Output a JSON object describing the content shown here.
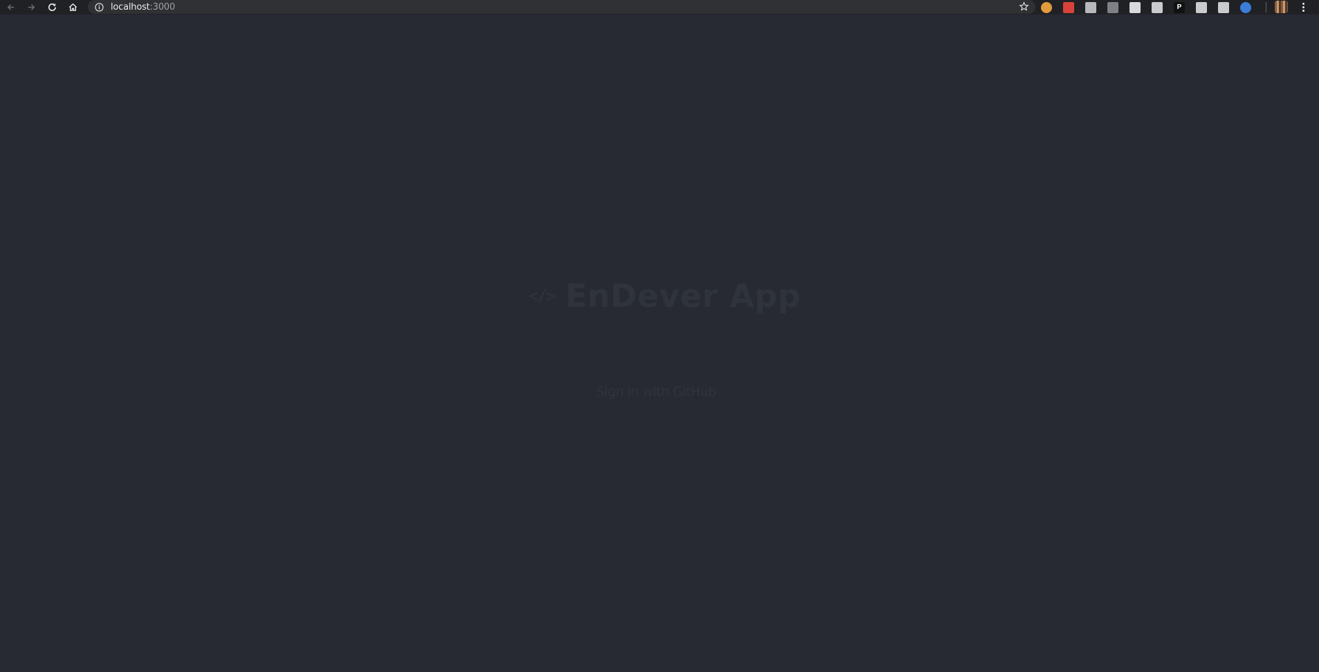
{
  "browser": {
    "url_host": "localhost",
    "url_port": ":3000",
    "nav": {
      "back_icon": "arrow-left-icon",
      "forward_icon": "arrow-right-icon",
      "reload_icon": "reload-icon",
      "home_icon": "home-icon"
    },
    "extensions": [
      {
        "name": "cookie-extension-icon",
        "color": "#e09b3d"
      },
      {
        "name": "red-extension-icon",
        "color": "#d9423b"
      },
      {
        "name": "gear-extension-icon",
        "color": "#b7b9bd"
      },
      {
        "name": "ublock-extension-icon",
        "color": "#7d8086"
      },
      {
        "name": "mail-extension-icon",
        "color": "#d7d9dc"
      },
      {
        "name": "wrench-extension-icon",
        "color": "#c9cbce"
      },
      {
        "name": "p-extension-icon",
        "color": "#111111",
        "label": "P"
      },
      {
        "name": "k-extension-icon",
        "color": "#c9cbce"
      },
      {
        "name": "css-extension-icon",
        "color": "#c9cbce"
      },
      {
        "name": "globe-extension-icon",
        "color": "#3b7dd8"
      }
    ]
  },
  "app": {
    "logo_icon": "</>",
    "title": "EnDever App",
    "signin_label": "Sign in with GitHub"
  },
  "colors": {
    "page_background": "#272a33",
    "toolbar_background": "#202124",
    "faded_text": "#2f333c"
  }
}
